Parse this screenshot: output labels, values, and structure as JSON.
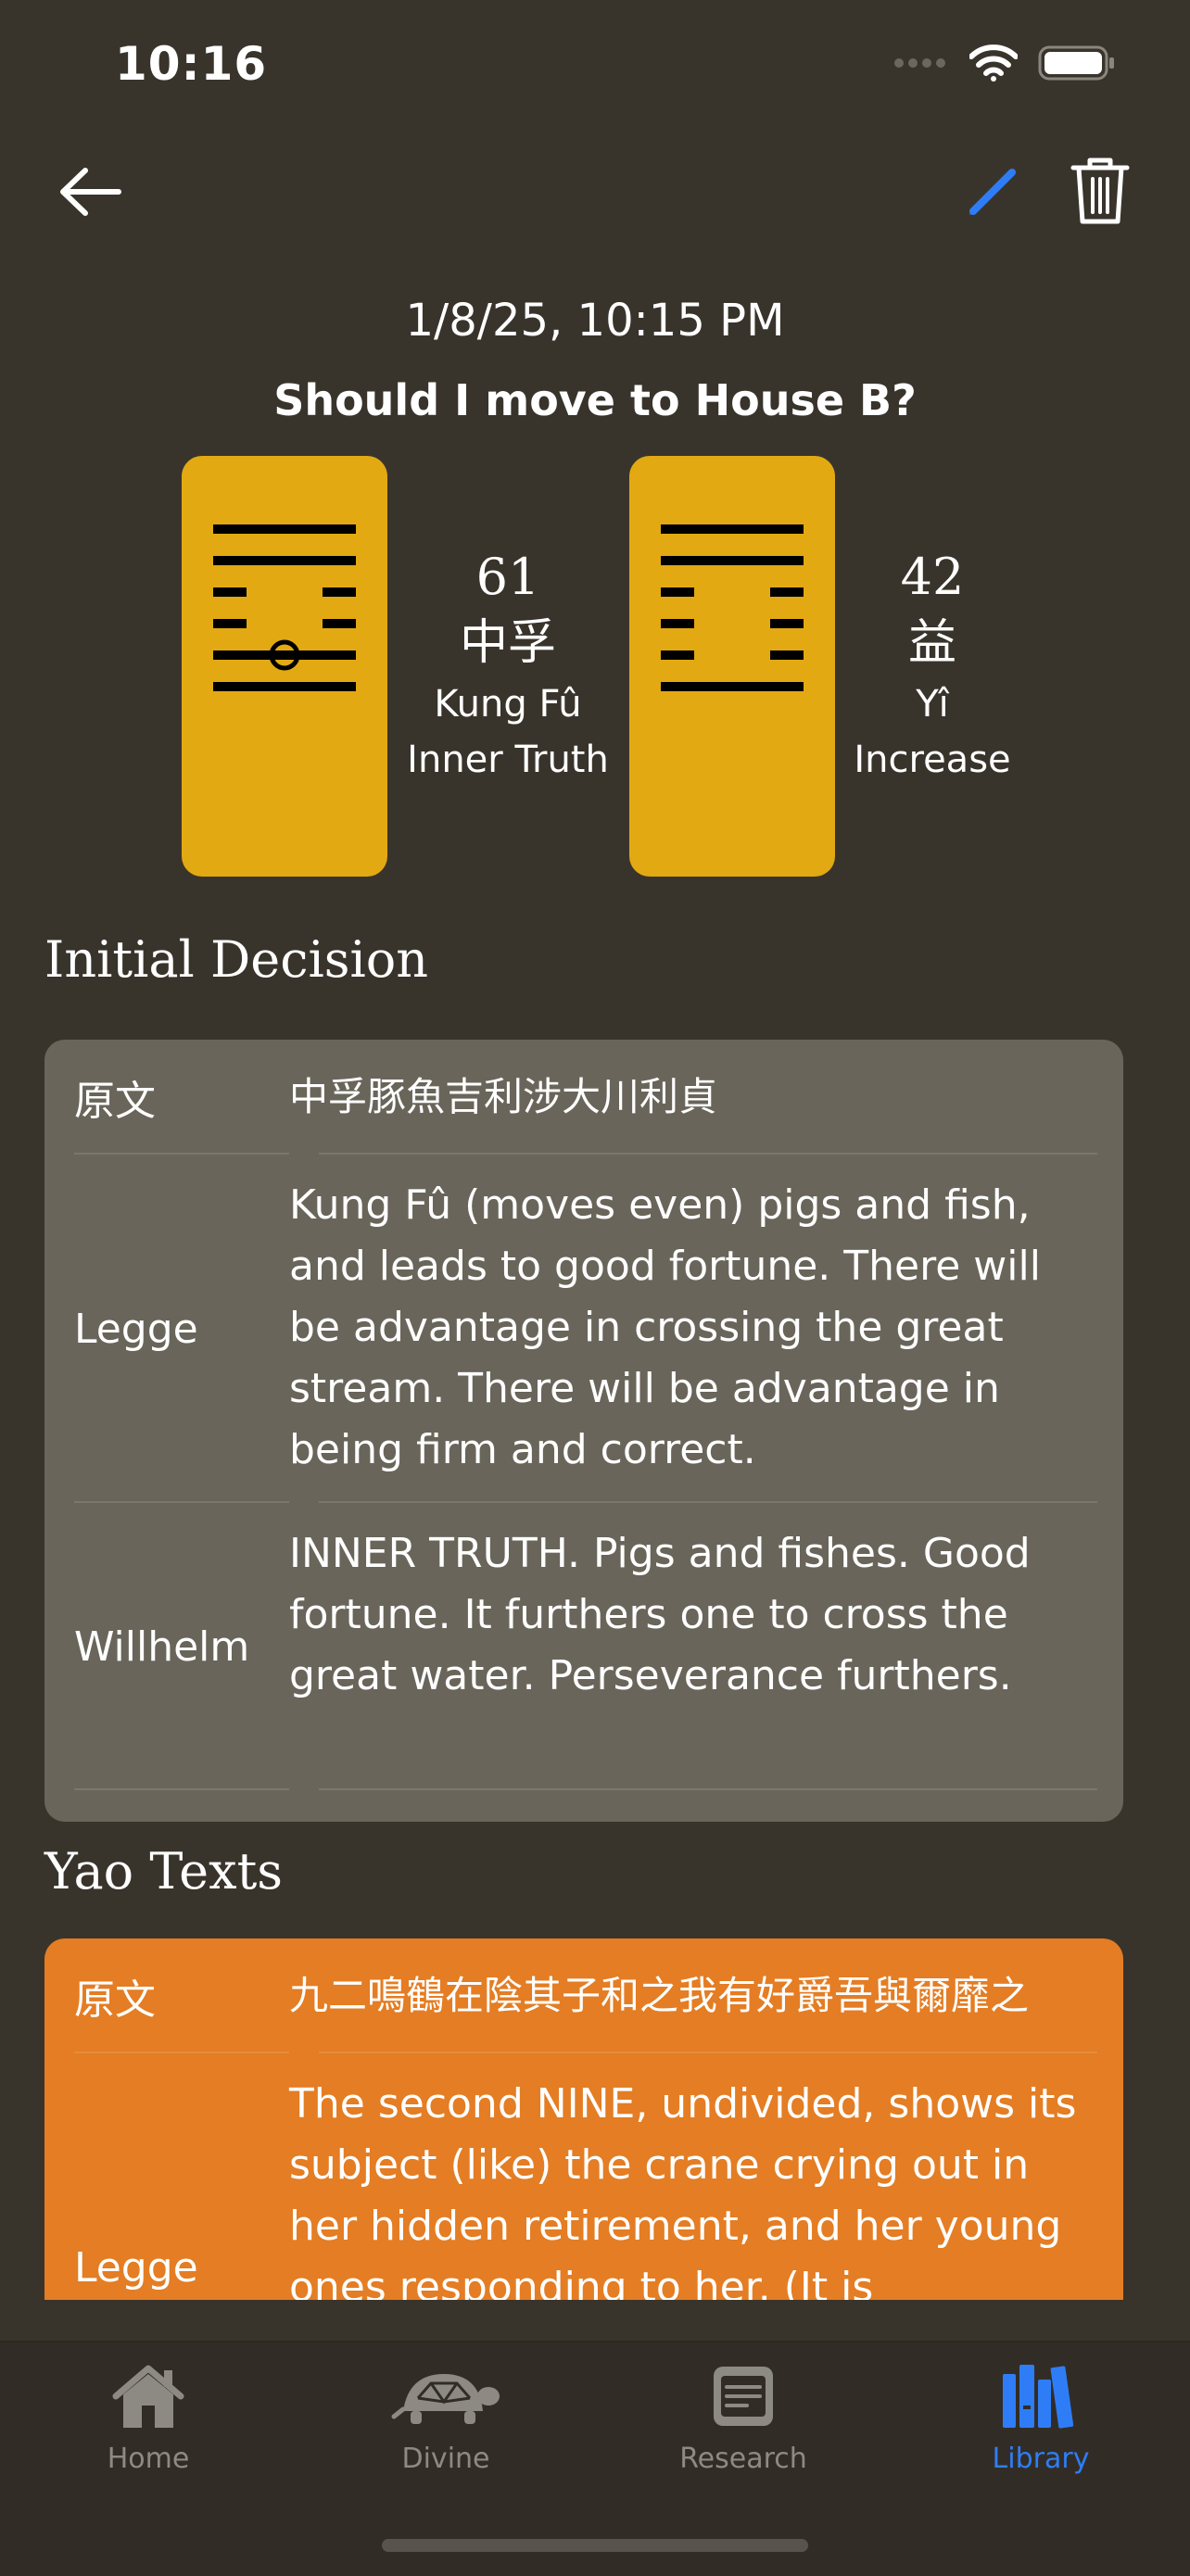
{
  "status": {
    "time": "10:16"
  },
  "reading": {
    "date": "1/8/25, 10:15 PM",
    "question": "Should I move to House B?"
  },
  "primary_hexagram": {
    "number": "61",
    "chinese": "中孚",
    "pinyin": "Kung Fû",
    "english": "Inner Truth",
    "lines_top_to_bottom": [
      "yang",
      "yang",
      "yin",
      "yin",
      "yang-moving",
      "yang"
    ]
  },
  "relating_hexagram": {
    "number": "42",
    "chinese": "益",
    "pinyin": "Yî",
    "english": "Increase",
    "lines_top_to_bottom": [
      "yang",
      "yang",
      "yin",
      "yin",
      "yin",
      "yang"
    ]
  },
  "initial_decision": {
    "title": "Initial Decision",
    "rows": [
      {
        "label": "原文",
        "text": "中孚豚魚吉利涉大川利貞"
      },
      {
        "label": "Legge",
        "text": "Kung Fû (moves even) pigs and fish, and leads to good fortune. There will be advantage in crossing the great stream. There will be advantage in being firm and correct."
      },
      {
        "label": "Willhelm",
        "text": "INNER TRUTH. Pigs and fishes. Good fortune. It furthers one to cross the great water. Perseverance furthers."
      }
    ]
  },
  "yao_texts": {
    "title": "Yao Texts",
    "rows": [
      {
        "label": "原文",
        "text": "九二鳴鶴在陰其子和之我有好爵吾與爾靡之"
      },
      {
        "label": "Legge",
        "text": "The second NINE, undivided, shows its subject (like) the crane crying out in her hidden retirement, and her young ones responding to her. (It is"
      }
    ]
  },
  "tabs": [
    {
      "label": "Home",
      "icon": "house-icon",
      "active": false
    },
    {
      "label": "Divine",
      "icon": "turtle-icon",
      "active": false
    },
    {
      "label": "Research",
      "icon": "document-icon",
      "active": false
    },
    {
      "label": "Library",
      "icon": "books-icon",
      "active": true
    }
  ],
  "colors": {
    "background": "#39342b",
    "hexagram_card": "#e2a912",
    "panel_gray": "#69655a",
    "panel_orange": "#e47d23",
    "accent": "#2f7df6"
  }
}
